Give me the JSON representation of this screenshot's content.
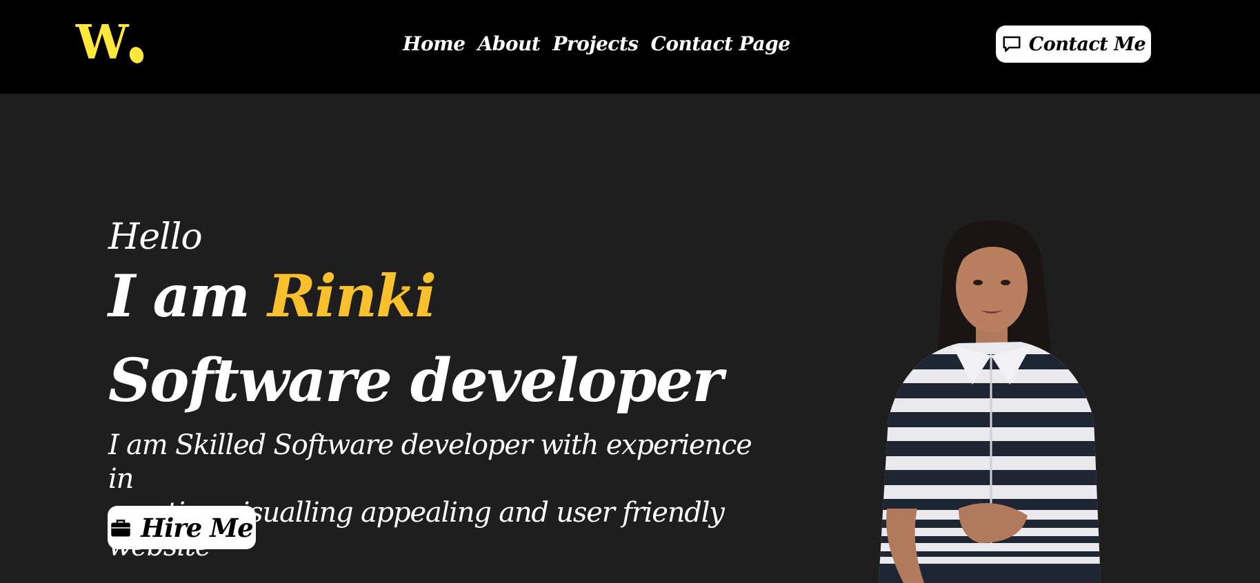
{
  "header": {
    "logo_text": "W",
    "logo_color": "#ffe83a",
    "nav": [
      {
        "label": "Home"
      },
      {
        "label": "About"
      },
      {
        "label": "Projects"
      },
      {
        "label": "Contact Page"
      }
    ],
    "contact_button": {
      "label": "Contact Me",
      "icon": "chat-bubble-icon"
    }
  },
  "hero": {
    "greeting": "Hello",
    "intro_prefix": "I am",
    "name": "Rinki",
    "name_color": "#f7c02c",
    "role": "Software developer",
    "description_line1": "I am Skilled Software developer with experience in",
    "description_line2": "creating visualling appealing and user friendly website",
    "hire_button": {
      "label": "Hire Me",
      "icon": "briefcase-icon"
    }
  },
  "colors": {
    "header_bg": "#000000",
    "page_bg": "#1e1e1e",
    "text": "#ffffff",
    "button_bg": "#ffffff"
  }
}
